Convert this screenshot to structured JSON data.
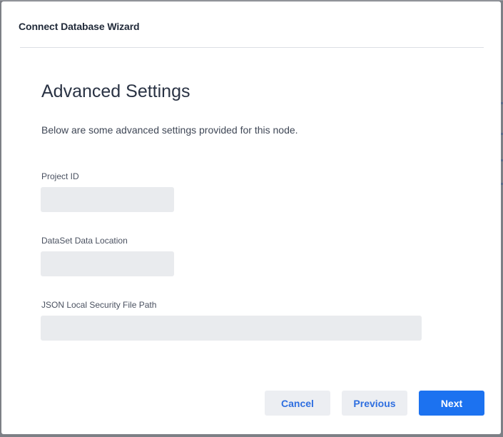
{
  "dialog": {
    "title": "Connect Database Wizard"
  },
  "section": {
    "title": "Advanced Settings",
    "description": "Below are some advanced settings provided for this node."
  },
  "fields": {
    "project_id": {
      "label": "Project ID",
      "value": "",
      "placeholder": ""
    },
    "dataset_location": {
      "label": "DataSet Data Location",
      "value": "",
      "placeholder": ""
    },
    "json_security_path": {
      "label": "JSON Local Security File Path",
      "value": "",
      "placeholder": ""
    }
  },
  "footer": {
    "cancel_label": "Cancel",
    "previous_label": "Previous",
    "next_label": "Next"
  },
  "colors": {
    "primary": "#1c72f0",
    "secondary_text": "#2f6fe0",
    "input_bg": "#e9ebee",
    "overlay": "#7d8086"
  }
}
